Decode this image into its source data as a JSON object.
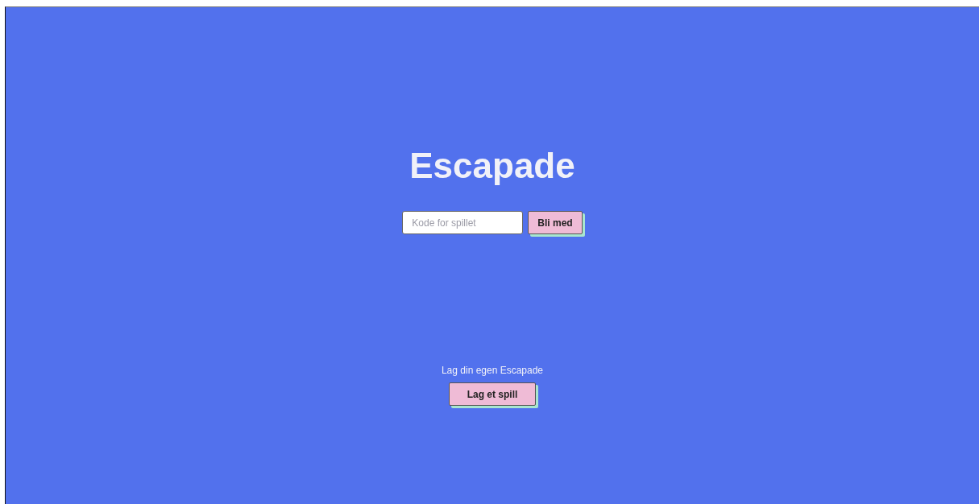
{
  "title": "Escapade",
  "join": {
    "code_field": {
      "placeholder": "Kode for spillet"
    },
    "button": "Bli med"
  },
  "create": {
    "label": "Lag din egen Escapade",
    "button": "Lag et spill"
  }
}
